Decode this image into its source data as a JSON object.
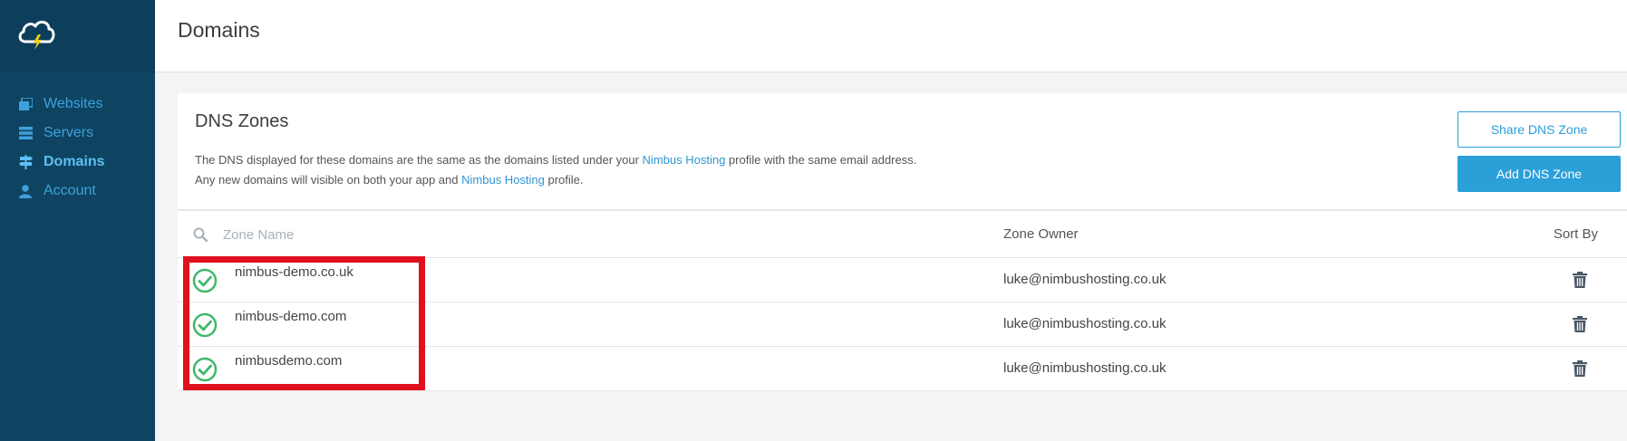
{
  "sidebar": {
    "logo_icon": "cloud-lightning-icon",
    "items": [
      {
        "label": "Websites",
        "icon": "websites-icon",
        "active": false
      },
      {
        "label": "Servers",
        "icon": "servers-icon",
        "active": false
      },
      {
        "label": "Domains",
        "icon": "signpost-icon",
        "active": true
      },
      {
        "label": "Account",
        "icon": "user-icon",
        "active": false
      }
    ]
  },
  "header": {
    "title": "Domains"
  },
  "card": {
    "title": "DNS Zones",
    "desc_line1_a": "The DNS displayed for these domains are the same as the domains listed under your ",
    "desc_line1_link": "Nimbus Hosting",
    "desc_line1_b": " profile with the same email address.",
    "desc_line2_a": "Any new domains will visible on both your app and ",
    "desc_line2_link": "Nimbus Hosting",
    "desc_line2_b": " profile.",
    "share_button": "Share DNS Zone",
    "add_button": "Add DNS Zone"
  },
  "table": {
    "search_placeholder": "Zone Name",
    "owner_header": "Zone Owner",
    "sort_label": "Sort By",
    "rows": [
      {
        "zone": "nimbus-demo.co.uk",
        "owner": "luke@nimbushosting.co.uk",
        "status": "verified"
      },
      {
        "zone": "nimbus-demo.com",
        "owner": "luke@nimbushosting.co.uk",
        "status": "verified"
      },
      {
        "zone": "nimbusdemo.com",
        "owner": "luke@nimbushosting.co.uk",
        "status": "verified"
      }
    ]
  },
  "colors": {
    "sidebar_bg": "#0e4462",
    "accent": "#2a9fd8",
    "check_green": "#3fb86a",
    "highlight_red": "#e0111c"
  }
}
